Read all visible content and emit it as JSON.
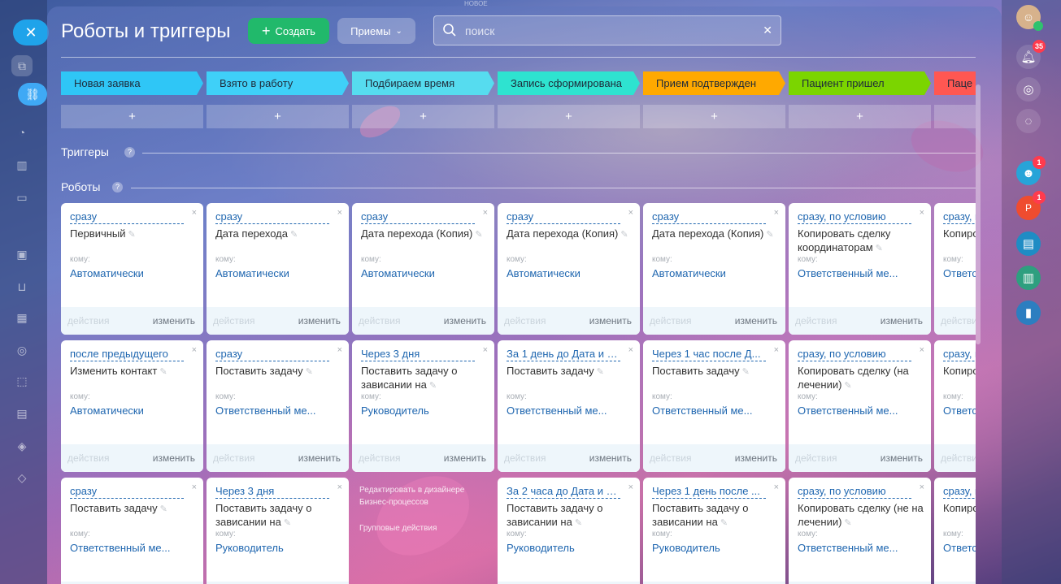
{
  "app": {
    "title": "Роботы и триггеры",
    "top_hint": "НОВОЕ"
  },
  "header": {
    "create_label": "Создать",
    "receptions_label": "Приемы",
    "search_placeholder": "поиск"
  },
  "stages": [
    {
      "label": "Новая заявка",
      "color": "#2fc6f6"
    },
    {
      "label": "Взято в работу",
      "color": "#3fd0f8"
    },
    {
      "label": "Подбираем время",
      "color": "#56dcef"
    },
    {
      "label": "Запись сформирована",
      "color": "#2ee3d0"
    },
    {
      "label": "Прием подтвержден",
      "color": "#ffa900"
    },
    {
      "label": "Пациент пришел",
      "color": "#7bd500"
    },
    {
      "label": "Паце",
      "color": "#ff5752"
    }
  ],
  "add_symbol": "+",
  "sections": {
    "triggers": "Триггеры",
    "robots": "Роботы",
    "help": "?"
  },
  "card_labels": {
    "to": "кому:",
    "actions": "действия",
    "edit": "изменить",
    "close": "×",
    "pencil": "✎"
  },
  "robot_rows": [
    [
      {
        "when": "сразу",
        "name": "Первичный",
        "who": "Автоматически"
      },
      {
        "when": "сразу",
        "name": "Дата перехода",
        "who": "Автоматически"
      },
      {
        "when": "сразу",
        "name": "Дата перехода (Копия)",
        "who": "Автоматически"
      },
      {
        "when": "сразу",
        "name": "Дата перехода (Копия)",
        "who": "Автоматически"
      },
      {
        "when": "сразу",
        "name": "Дата перехода (Копия)",
        "who": "Автоматически"
      },
      {
        "when": "сразу, по условию",
        "name": "Копировать сделку координаторам",
        "who": "Ответственный ме..."
      },
      {
        "when": "сразу, по условию",
        "name": "Копирова (были",
        "who": "Ответс"
      }
    ],
    [
      {
        "when": "после предыдущего",
        "name": "Изменить контакт",
        "who": "Автоматически"
      },
      {
        "when": "сразу",
        "name": "Поставить задачу",
        "who": "Ответственный ме..."
      },
      {
        "when": "Через 3 дня",
        "name": "Поставить задачу о зависании на",
        "who": "Руководитель"
      },
      {
        "when": "За 1 день до Дата и в...",
        "name": "Поставить задачу",
        "who": "Ответственный ме..."
      },
      {
        "when": "Через 1 час после Д...",
        "name": "Поставить задачу",
        "who": "Ответственный ме..."
      },
      {
        "when": "сразу, по условию",
        "name": "Копировать сделку (на лечении)",
        "who": "Ответственный ме..."
      },
      {
        "when": "сразу, по условию",
        "name": "Копирова (были",
        "who": "Ответс"
      }
    ],
    [
      {
        "when": "сразу",
        "name": "Поставить задачу",
        "who": "Ответственный ме..."
      },
      {
        "when": "Через 3 дня",
        "name": "Поставить задачу о зависании на",
        "who": "Руководитель"
      },
      null,
      {
        "when": "За 2 часа до Дата и в...",
        "name": "Поставить задачу о зависании на",
        "who": "Руководитель"
      },
      {
        "when": "Через 1 день после ...",
        "name": "Поставить задачу о зависании на",
        "who": "Руководитель"
      },
      {
        "when": "сразу, по условию",
        "name": "Копировать сделку (не на лечении)",
        "who": "Ответственный ме..."
      },
      {
        "when": "сразу, по условию",
        "name": "Копирова были)",
        "who": "Ответс"
      }
    ]
  ],
  "bp_links": {
    "designer": "Редактировать в дизайнере Бизнес-процессов",
    "group": "Групповые действия"
  },
  "right_rail": {
    "notifications_count": "35",
    "bot_count": "1",
    "avatar_letter": "Р",
    "avatar_count": "1"
  }
}
